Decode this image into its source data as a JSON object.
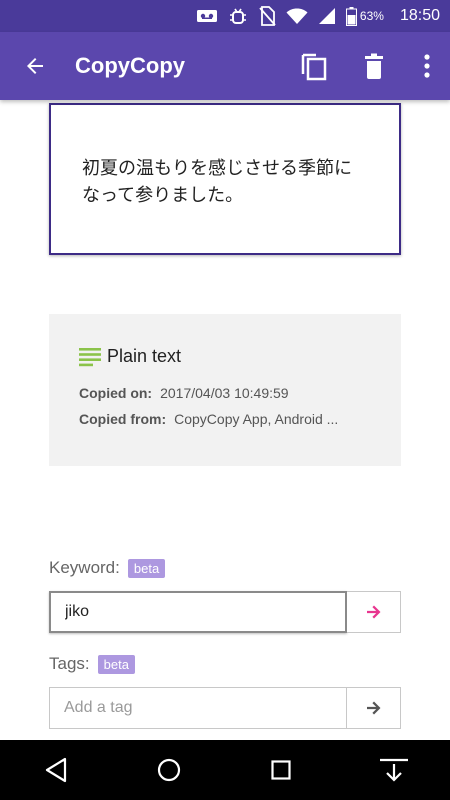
{
  "status_bar": {
    "battery_percent": "63%",
    "time": "18:50"
  },
  "app_bar": {
    "title": "CopyCopy",
    "icons": [
      "back-arrow-icon",
      "copy-icon",
      "delete-icon",
      "more-vert-icon"
    ]
  },
  "clip": {
    "text": "初夏の温もりを感じさせる季節になって参りました。"
  },
  "info": {
    "type_label": "Plain text",
    "copied_on_label": "Copied on:",
    "copied_on_value": "2017/04/03 10:49:59",
    "copied_from_label": "Copied from:",
    "copied_from_value": "CopyCopy App, Android ..."
  },
  "keyword": {
    "label": "Keyword:",
    "badge": "beta",
    "value": "jiko"
  },
  "tags": {
    "label": "Tags:",
    "badge": "beta",
    "placeholder": "Add a tag"
  },
  "colors": {
    "status_bar": "#4a3a9a",
    "app_bar": "#5b47ad",
    "accent_pink": "#e8368f",
    "text_icon_green": "#8bc34a",
    "beta_badge": "#ad98e0"
  }
}
